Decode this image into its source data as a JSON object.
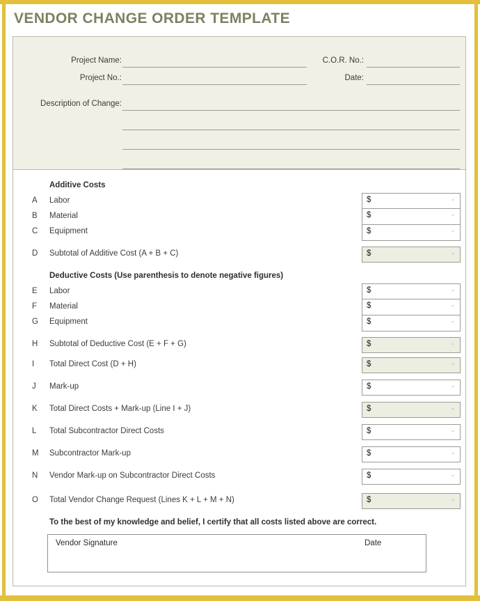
{
  "document": {
    "title": "VENDOR CHANGE ORDER TEMPLATE",
    "accent_color": "#e2c03c",
    "title_color": "#7d8160",
    "header_block_color": "#f0f0e7",
    "subtotal_fill_color": "#eceee1",
    "watermark": ""
  },
  "header": {
    "fields": [
      {
        "label": "Project Name:",
        "value": ""
      },
      {
        "label": "Project No.:",
        "value": ""
      },
      {
        "label": "C.O.R. No.:",
        "value": ""
      },
      {
        "label": "Date:",
        "value": ""
      },
      {
        "label": "Description of Change:",
        "value": ""
      }
    ]
  },
  "sections": {
    "additive_heading": "Additive Costs",
    "deductive_heading": "Deductive Costs (Use parenthesis to denote negative figures)"
  },
  "rows": [
    {
      "letter": "A",
      "label": "Labor",
      "currency": "$",
      "value": "-",
      "highlight": false
    },
    {
      "letter": "B",
      "label": "Material",
      "currency": "$",
      "value": "-",
      "highlight": false
    },
    {
      "letter": "C",
      "label": "Equipment",
      "currency": "$",
      "value": "-",
      "highlight": false
    },
    {
      "letter": "D",
      "label": "Subtotal of Additive Cost (A + B + C)",
      "currency": "$",
      "value": "-",
      "highlight": true
    },
    {
      "letter": "E",
      "label": "Labor",
      "currency": "$",
      "value": "-",
      "highlight": false
    },
    {
      "letter": "F",
      "label": "Material",
      "currency": "$",
      "value": "-",
      "highlight": false
    },
    {
      "letter": "G",
      "label": "Equipment",
      "currency": "$",
      "value": "-",
      "highlight": false
    },
    {
      "letter": "H",
      "label": "Subtotal of Deductive Cost (E + F + G)",
      "currency": "$",
      "value": "-",
      "highlight": true
    },
    {
      "letter": "I",
      "label": "Total Direct Cost (D + H)",
      "currency": "$",
      "value": "-",
      "highlight": true
    },
    {
      "letter": "J",
      "label": "Mark-up",
      "currency": "$",
      "value": "-",
      "highlight": false
    },
    {
      "letter": "K",
      "label": "Total Direct Costs + Mark-up (Line I + J)",
      "currency": "$",
      "value": "-",
      "highlight": true
    },
    {
      "letter": "L",
      "label": "Total Subcontractor Direct Costs",
      "currency": "$",
      "value": "-",
      "highlight": false
    },
    {
      "letter": "M",
      "label": "Subcontractor Mark-up",
      "currency": "$",
      "value": "-",
      "highlight": false
    },
    {
      "letter": "N",
      "label": "Vendor Mark-up on Subcontractor Direct Costs",
      "currency": "$",
      "value": "-",
      "highlight": false
    },
    {
      "letter": "O",
      "label": "Total Vendor Change Request (Lines K + L + M + N)",
      "currency": "$",
      "value": "-",
      "highlight": true
    }
  ],
  "certification": {
    "statement": "To the best of my knowledge and belief, I certify that all costs listed above are correct.",
    "signature_label": "Vendor Signature",
    "date_label": "Date"
  }
}
